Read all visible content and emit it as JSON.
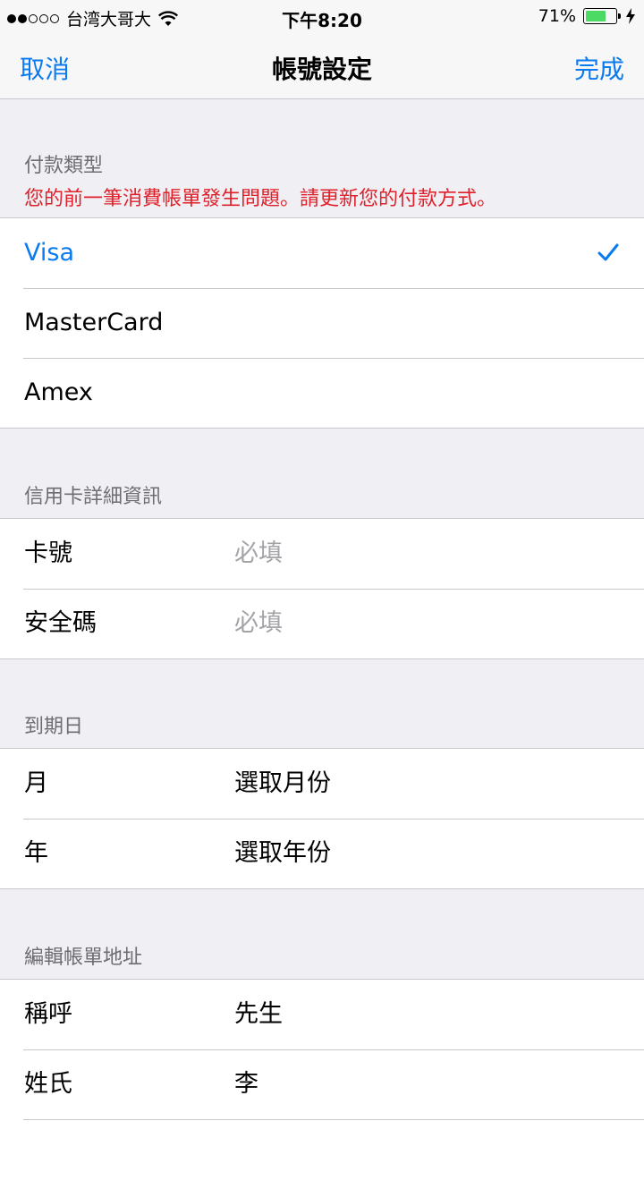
{
  "status_bar": {
    "carrier": "台湾大哥大",
    "time": "下午8:20",
    "battery_percent": "71%",
    "battery_level": 0.71,
    "signal_filled": 2,
    "signal_total": 5
  },
  "nav": {
    "cancel": "取消",
    "title": "帳號設定",
    "done": "完成"
  },
  "payment": {
    "header": "付款類型",
    "error": "您的前一筆消費帳單發生問題。請更新您的付款方式。",
    "options": [
      {
        "label": "Visa",
        "selected": true
      },
      {
        "label": "MasterCard",
        "selected": false
      },
      {
        "label": "Amex",
        "selected": false
      }
    ]
  },
  "card": {
    "header": "信用卡詳細資訊",
    "number_label": "卡號",
    "number_placeholder": "必填",
    "cvv_label": "安全碼",
    "cvv_placeholder": "必填"
  },
  "expiry": {
    "header": "到期日",
    "month_label": "月",
    "month_value": "選取月份",
    "year_label": "年",
    "year_value": "選取年份"
  },
  "billing": {
    "header": "編輯帳單地址",
    "title_label": "稱呼",
    "title_value": "先生",
    "surname_label": "姓氏",
    "surname_value": "李"
  },
  "colors": {
    "accent": "#0a7af0",
    "error": "#e0202a",
    "battery": "#4cd964",
    "background": "#efeff4"
  }
}
